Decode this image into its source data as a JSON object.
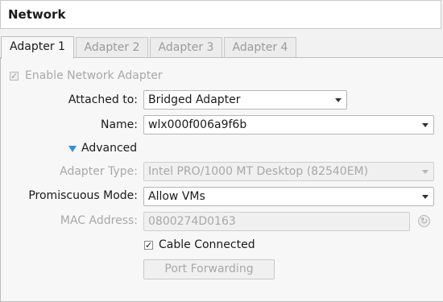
{
  "header": {
    "title": "Network"
  },
  "tabs": [
    {
      "label": "Adapter 1",
      "active": true
    },
    {
      "label": "Adapter 2",
      "active": false
    },
    {
      "label": "Adapter 3",
      "active": false
    },
    {
      "label": "Adapter 4",
      "active": false
    }
  ],
  "enable_adapter": {
    "label": "Enable Network Adapter",
    "checked": true,
    "enabled": false
  },
  "attached_to": {
    "label": "Attached to:",
    "value": "Bridged Adapter"
  },
  "name": {
    "label": "Name:",
    "value": "wlx000f006a9f6b"
  },
  "advanced": {
    "label": "Advanced",
    "expanded": true
  },
  "adapter_type": {
    "label": "Adapter Type:",
    "value": "Intel PRO/1000 MT Desktop (82540EM)",
    "enabled": false
  },
  "promiscuous_mode": {
    "label": "Promiscuous Mode:",
    "value": "Allow VMs"
  },
  "mac_address": {
    "label": "MAC Address:",
    "value": "0800274D0163",
    "enabled": false
  },
  "cable_connected": {
    "label": "Cable Connected",
    "checked": true
  },
  "port_forwarding": {
    "label": "Port Forwarding",
    "enabled": false
  },
  "icons": {
    "mac_refresh": "refresh-icon",
    "expander": "triangle-down-icon"
  },
  "colors": {
    "expander_accent": "#2f8fd8",
    "panel_bg": "#f7f7f7",
    "header_bg": "#ffffff"
  }
}
